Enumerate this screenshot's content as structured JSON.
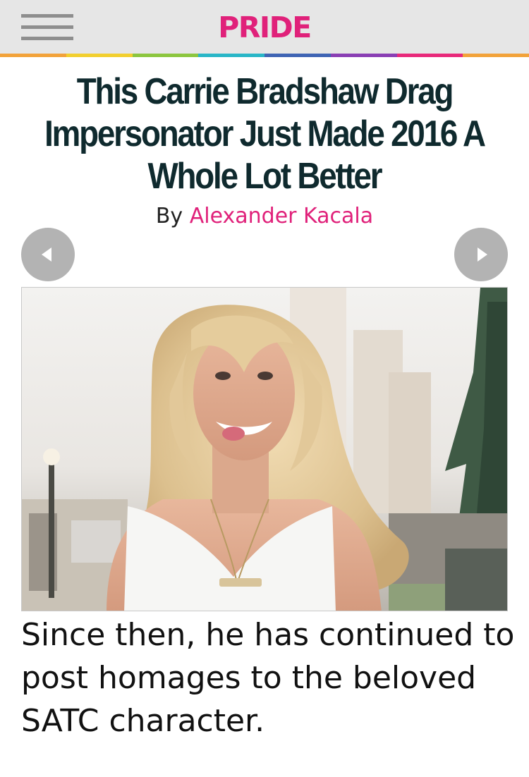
{
  "header": {
    "logo_text": "PRIDE",
    "menu_icon": "hamburger-menu-icon",
    "rainbow_colors": [
      "#f2a23a",
      "#f2cf2e",
      "#8cc63f",
      "#29b6c7",
      "#3f64b4",
      "#8a3fb4",
      "#e8297a",
      "#f2a23a"
    ]
  },
  "article": {
    "title": "This Carrie Bradshaw Drag Impersonator Just Made 2016 A Whole Lot Better",
    "byline_prefix": "By",
    "author": "Alexander Kacala",
    "caption": "Since then, he has continued to post homages to the beloved SATC character."
  },
  "gallery": {
    "prev_icon": "chevron-left-icon",
    "next_icon": "chevron-right-icon"
  },
  "colors": {
    "brand_pink": "#e0217a",
    "headline": "#0f2a2e",
    "topbar_bg": "#e6e6e6",
    "nav_button": "#b3b3b3"
  }
}
